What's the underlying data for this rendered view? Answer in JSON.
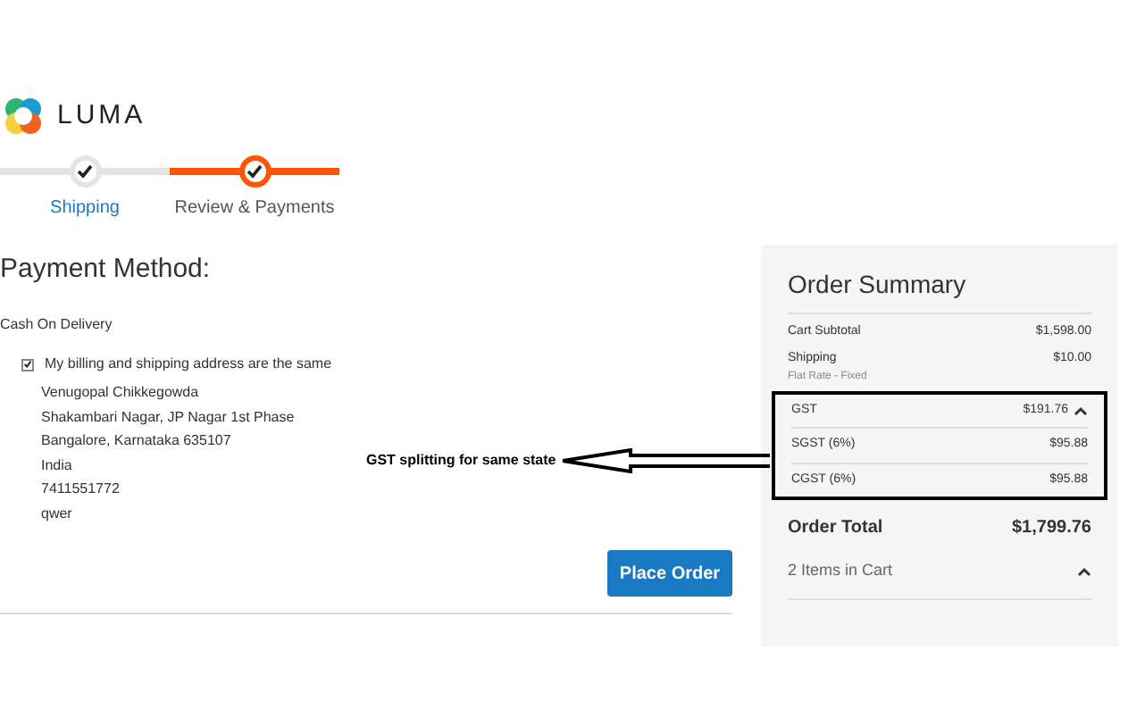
{
  "logo": {
    "text": "LUMA"
  },
  "steps": [
    {
      "label": "Shipping",
      "selected": false
    },
    {
      "label": "Review & Payments",
      "selected": true
    }
  ],
  "payment": {
    "title": "Payment Method:",
    "method": "Cash On Delivery",
    "same_address": {
      "label": "My billing and shipping address are the same",
      "checked": true
    },
    "address": [
      "Venugopal Chikkegowda",
      "Shakambari Nagar, JP Nagar 1st Phase",
      "Bangalore, Karnataka 635107",
      "India",
      "7411551772",
      "qwer"
    ],
    "button": "Place Order"
  },
  "annotation": {
    "text": "GST splitting for same state"
  },
  "summary": {
    "title": "Order Summary",
    "rows": [
      {
        "label": "Cart Subtotal",
        "value": "$1,598.00"
      },
      {
        "label": "Shipping",
        "note": "Flat Rate - Fixed",
        "value": "$10.00"
      }
    ],
    "tax": {
      "label": "GST",
      "value": "$191.76",
      "expanded": true,
      "children": [
        {
          "label": "SGST (6%)",
          "value": "$95.88"
        },
        {
          "label": "CGST (6%)",
          "value": "$95.88"
        }
      ]
    },
    "total": {
      "label": "Order Total",
      "value": "$1,799.76"
    },
    "items": {
      "label": "2 Items in Cart",
      "expanded": true
    }
  }
}
